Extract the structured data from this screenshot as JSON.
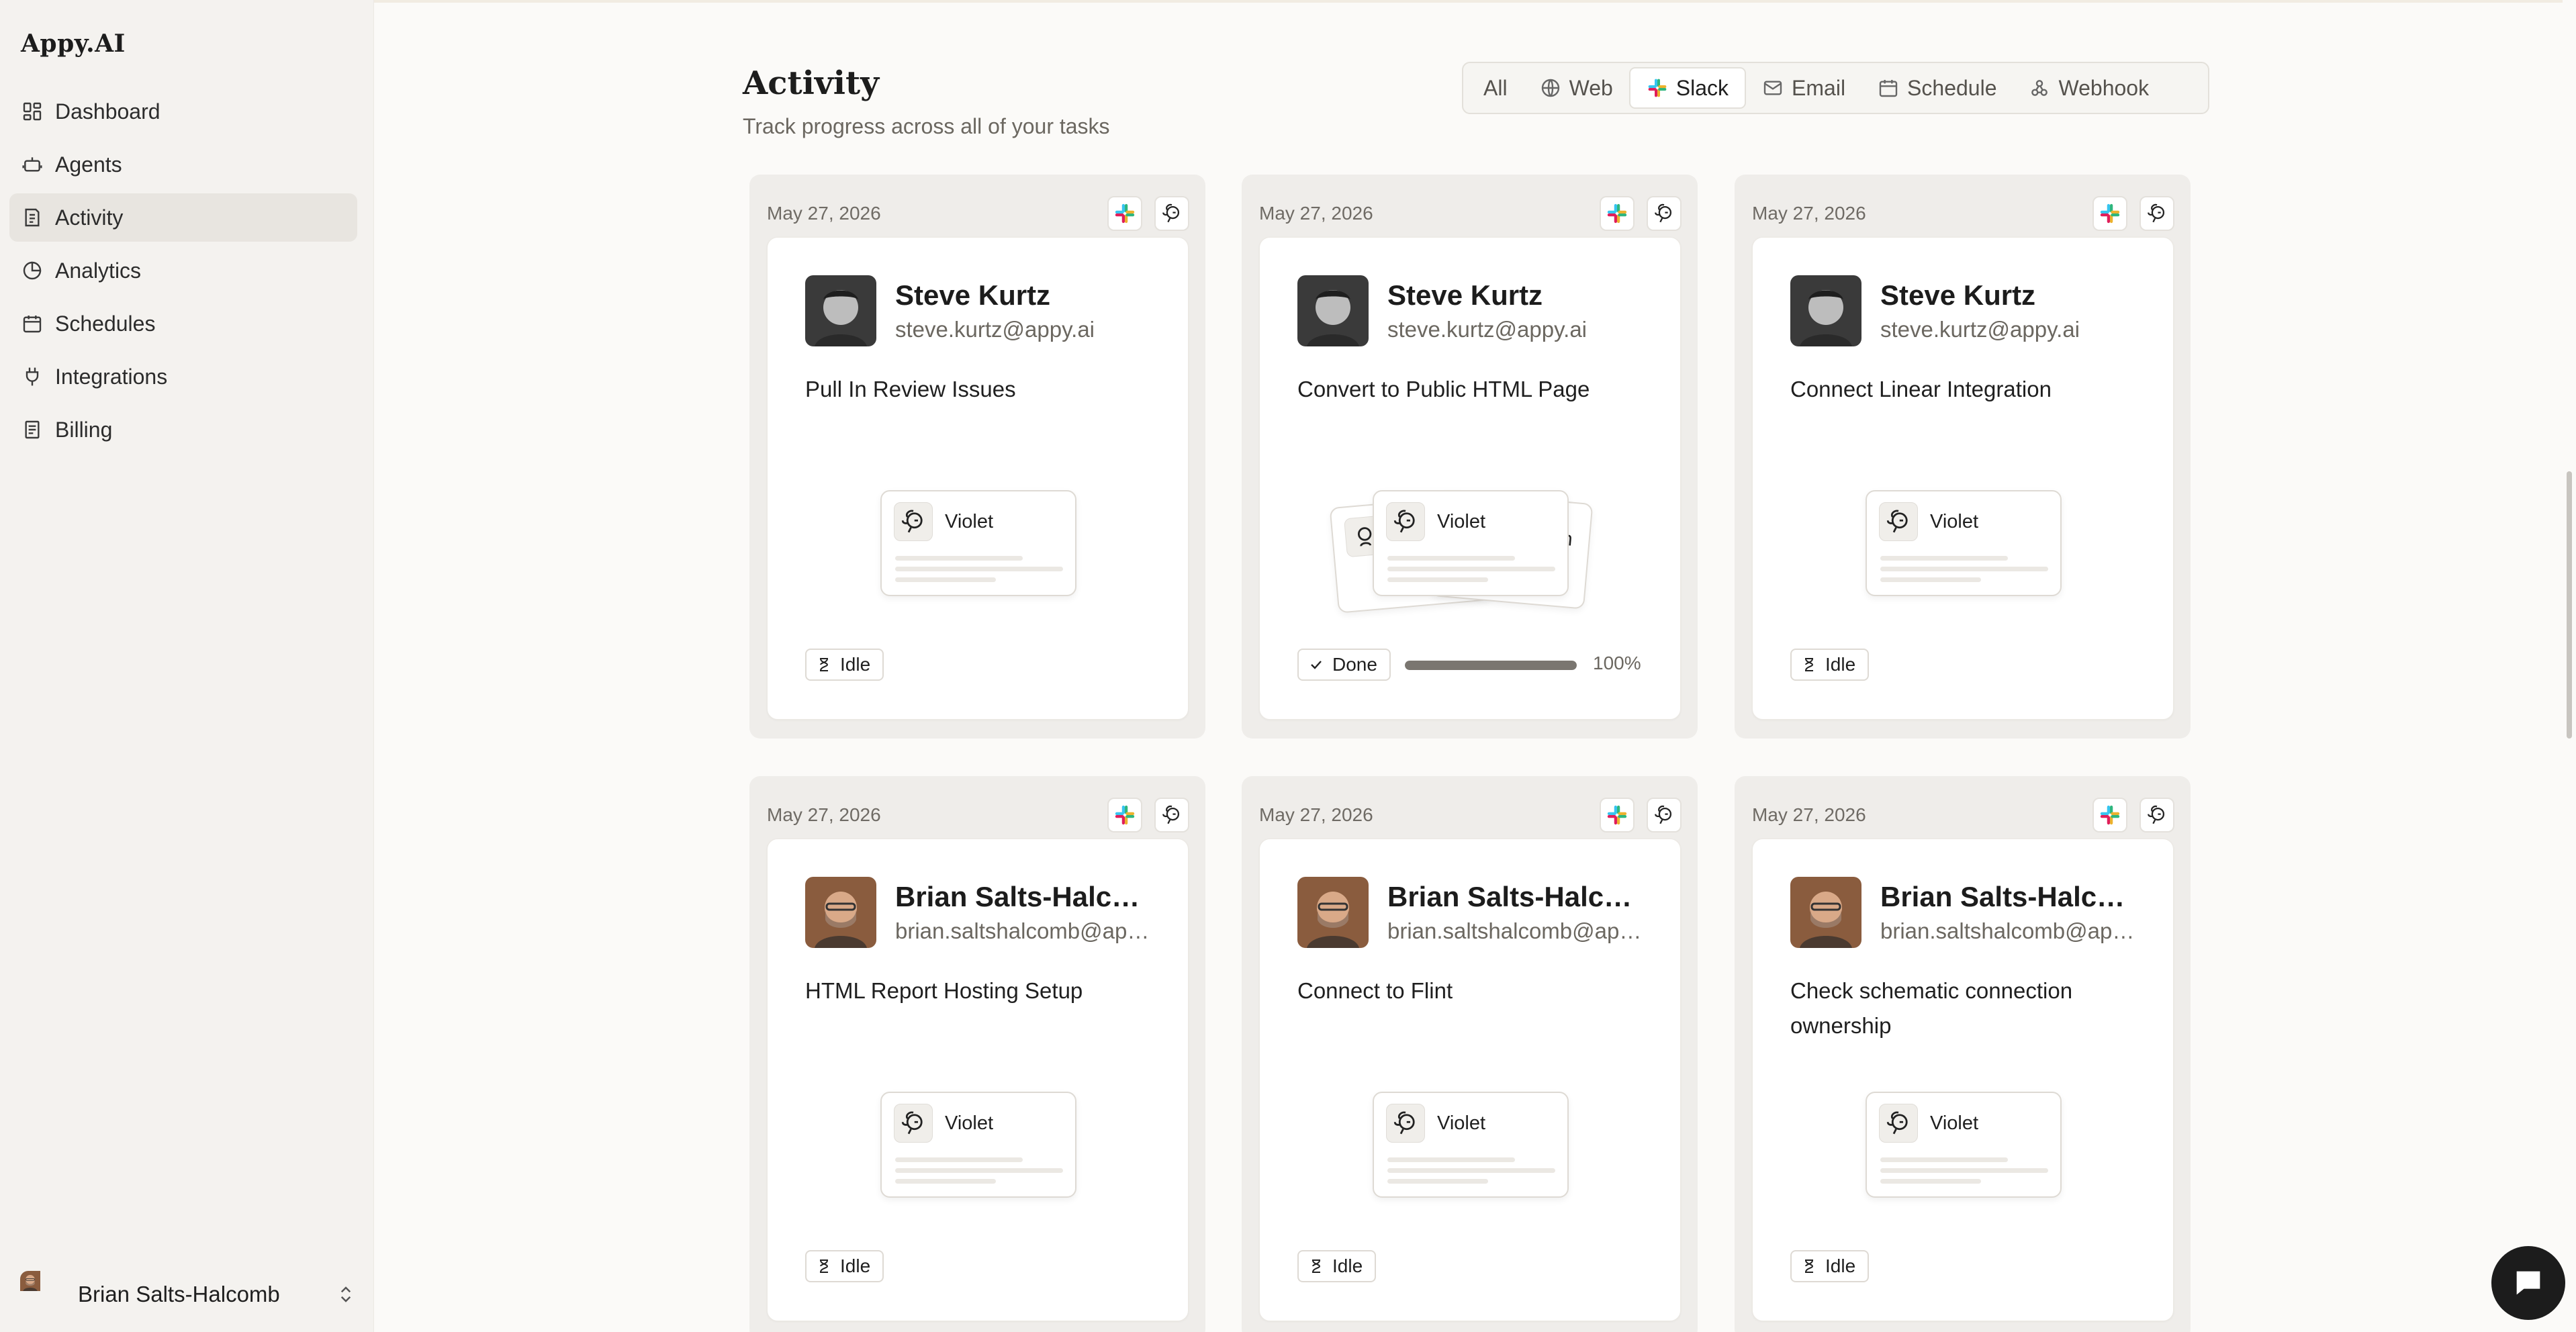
{
  "app": {
    "brand": "Appy.AI"
  },
  "sidebar": {
    "items": [
      {
        "label": "Dashboard",
        "icon": "dashboard-icon"
      },
      {
        "label": "Agents",
        "icon": "robot-icon"
      },
      {
        "label": "Activity",
        "icon": "activity-icon",
        "active": true
      },
      {
        "label": "Analytics",
        "icon": "pie-chart-icon"
      },
      {
        "label": "Schedules",
        "icon": "calendar-icon"
      },
      {
        "label": "Integrations",
        "icon": "plug-icon"
      },
      {
        "label": "Billing",
        "icon": "receipt-icon"
      }
    ],
    "user": {
      "name": "Brian Salts-Halcomb"
    }
  },
  "page": {
    "title": "Activity",
    "subtitle": "Track progress across all of your tasks"
  },
  "filters": [
    {
      "label": "All",
      "icon": ""
    },
    {
      "label": "Web",
      "icon": "globe-icon"
    },
    {
      "label": "Slack",
      "icon": "slack-icon",
      "active": true
    },
    {
      "label": "Email",
      "icon": "mail-icon"
    },
    {
      "label": "Schedule",
      "icon": "calendar-icon"
    },
    {
      "label": "Webhook",
      "icon": "webhook-icon"
    }
  ],
  "cards": [
    {
      "date": "May 27, 2026",
      "name": "Steve Kurtz",
      "email": "steve.kurtz@appy.ai",
      "task": "Pull In Review Issues",
      "agent": "Violet",
      "status": "Idle"
    },
    {
      "date": "May 27, 2026",
      "name": "Steve Kurtz",
      "email": "steve.kurtz@appy.ai",
      "task": "Convert to Public HTML Page",
      "agent": "Violet",
      "status": "Done",
      "progress": "100%",
      "progress_value": 1.0,
      "stacked_partial": "n"
    },
    {
      "date": "May 27, 2026",
      "name": "Steve Kurtz",
      "email": "steve.kurtz@appy.ai",
      "task": "Connect Linear Integration",
      "agent": "Violet",
      "status": "Idle"
    },
    {
      "date": "May 27, 2026",
      "name": "Brian Salts-Halcomb",
      "email": "brian.saltshalcomb@appy.ai",
      "task": "HTML Report Hosting Setup",
      "agent": "Violet",
      "status": "Idle"
    },
    {
      "date": "May 27, 2026",
      "name": "Brian Salts-Halcomb",
      "email": "brian.saltshalcomb@appy.ai",
      "task": "Connect to Flint",
      "agent": "Violet",
      "status": "Idle"
    },
    {
      "date": "May 27, 2026",
      "name": "Brian Salts-Halcomb",
      "email": "brian.saltshalcomb@appy.ai",
      "task": "Check schematic connection ownership",
      "agent": "Violet",
      "status": "Idle"
    }
  ],
  "colors": {
    "accent_dark": "#1c1c1c",
    "sidebar_bg": "#f4f2ef",
    "active_nav": "#e8e5e0",
    "card_outer": "#efedea"
  }
}
